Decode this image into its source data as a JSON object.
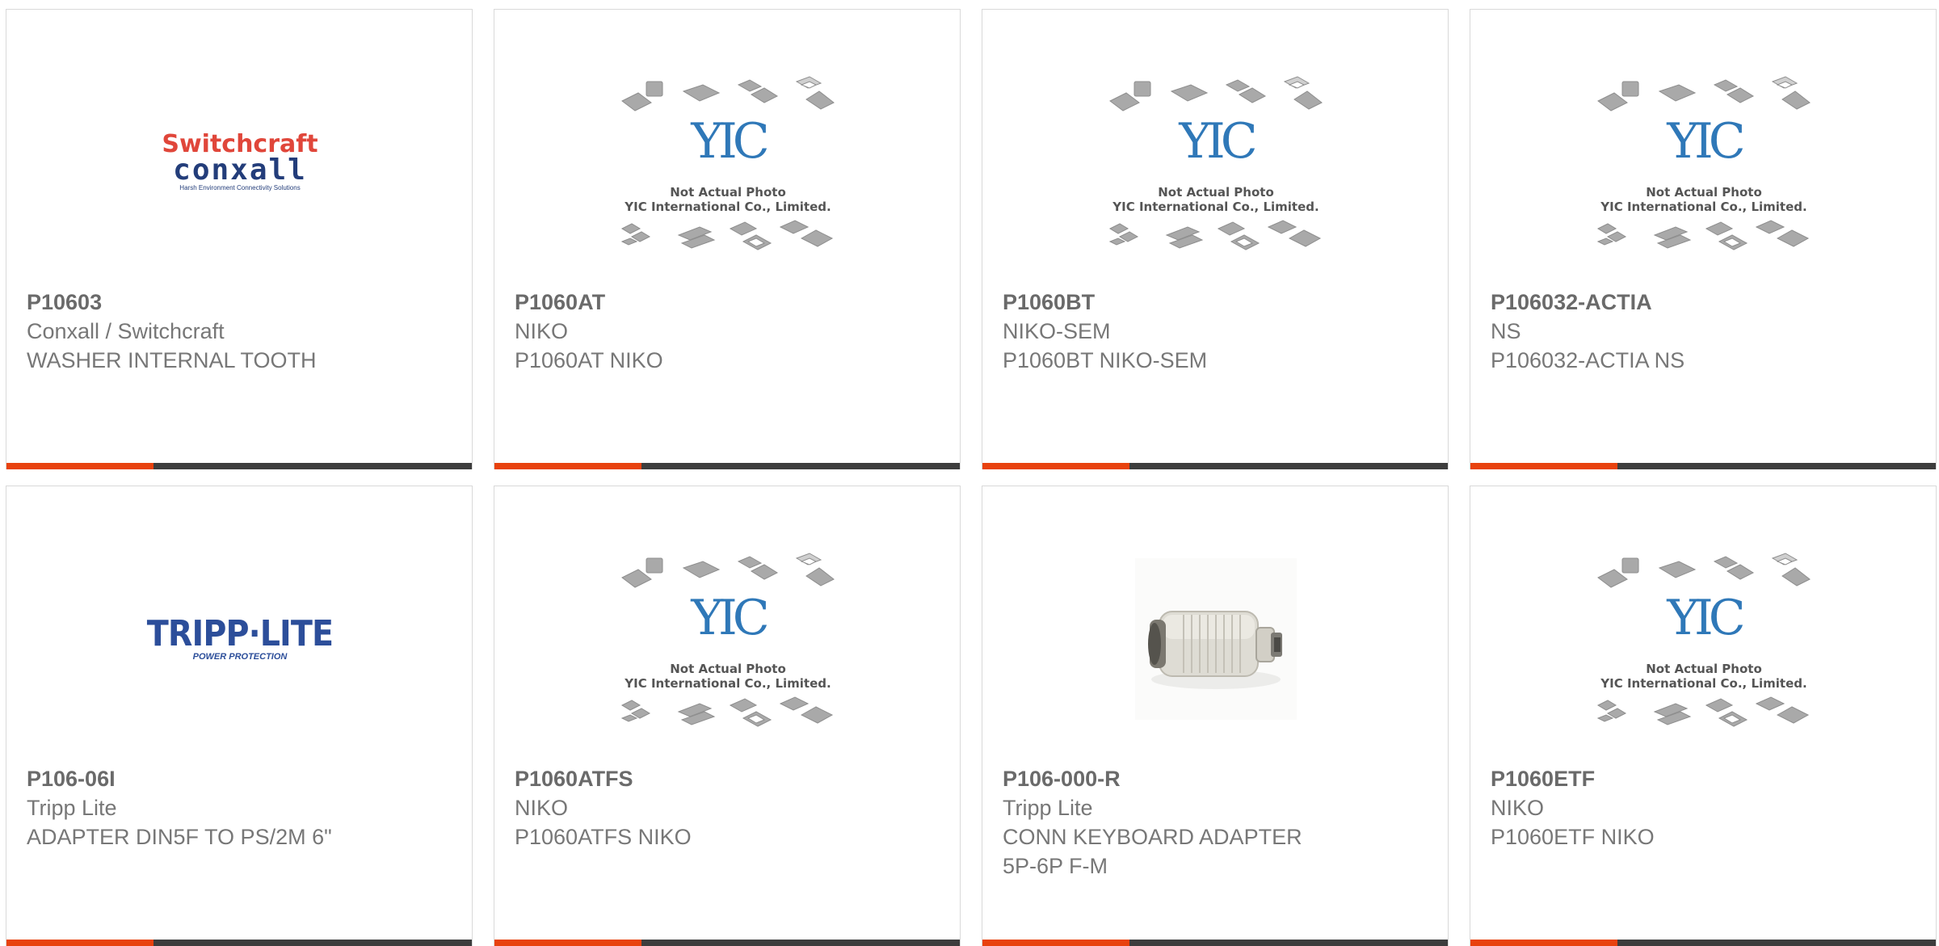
{
  "products": [
    {
      "part": "P10603",
      "maker": "Conxall / Switchcraft",
      "desc": "WASHER INTERNAL TOOTH",
      "image": "switchcraft-conxall-logo",
      "logo_text": [
        "Switchcraft",
        "conxall",
        "Harsh Environment Connectivity Solutions"
      ]
    },
    {
      "part": "P1060AT",
      "maker": "NIKO",
      "desc": "P1060AT NIKO",
      "image": "placeholder-photo",
      "caption": [
        "Not Actual Photo",
        "YIC International Co., Limited."
      ]
    },
    {
      "part": "P1060BT",
      "maker": "NIKO-SEM",
      "desc": "P1060BT NIKO-SEM",
      "image": "placeholder-photo",
      "caption": [
        "Not Actual Photo",
        "YIC International Co., Limited."
      ]
    },
    {
      "part": "P106032-ACTIA",
      "maker": "NS",
      "desc": "P106032-ACTIA NS",
      "image": "placeholder-photo",
      "caption": [
        "Not Actual Photo",
        "YIC International Co., Limited."
      ]
    },
    {
      "part": "P106-06I",
      "maker": "Tripp Lite",
      "desc": "ADAPTER DIN5F TO PS/2M 6\"",
      "image": "tripp-lite-logo",
      "logo_text": [
        "TRIPP·LITE",
        "POWER PROTECTION"
      ]
    },
    {
      "part": "P1060ATFS",
      "maker": "NIKO",
      "desc": "P1060ATFS NIKO",
      "image": "placeholder-photo",
      "caption": [
        "Not Actual Photo",
        "YIC International Co., Limited."
      ]
    },
    {
      "part": "P106-000-R",
      "maker": "Tripp Lite",
      "desc": "CONN KEYBOARD ADAPTER 5P-6P F-M",
      "image": "keyboard-adapter-photo"
    },
    {
      "part": "P1060ETF",
      "maker": "NIKO",
      "desc": "P1060ETF NIKO",
      "image": "placeholder-photo",
      "caption": [
        "Not Actual Photo",
        "YIC International Co., Limited."
      ]
    }
  ],
  "placeholder_logo": "YIC",
  "colors": {
    "accent": "#e8420e",
    "bar": "#3d3d3d",
    "text": "#777777",
    "border": "#d9d9d9",
    "yic_blue": "#2f78b8"
  }
}
